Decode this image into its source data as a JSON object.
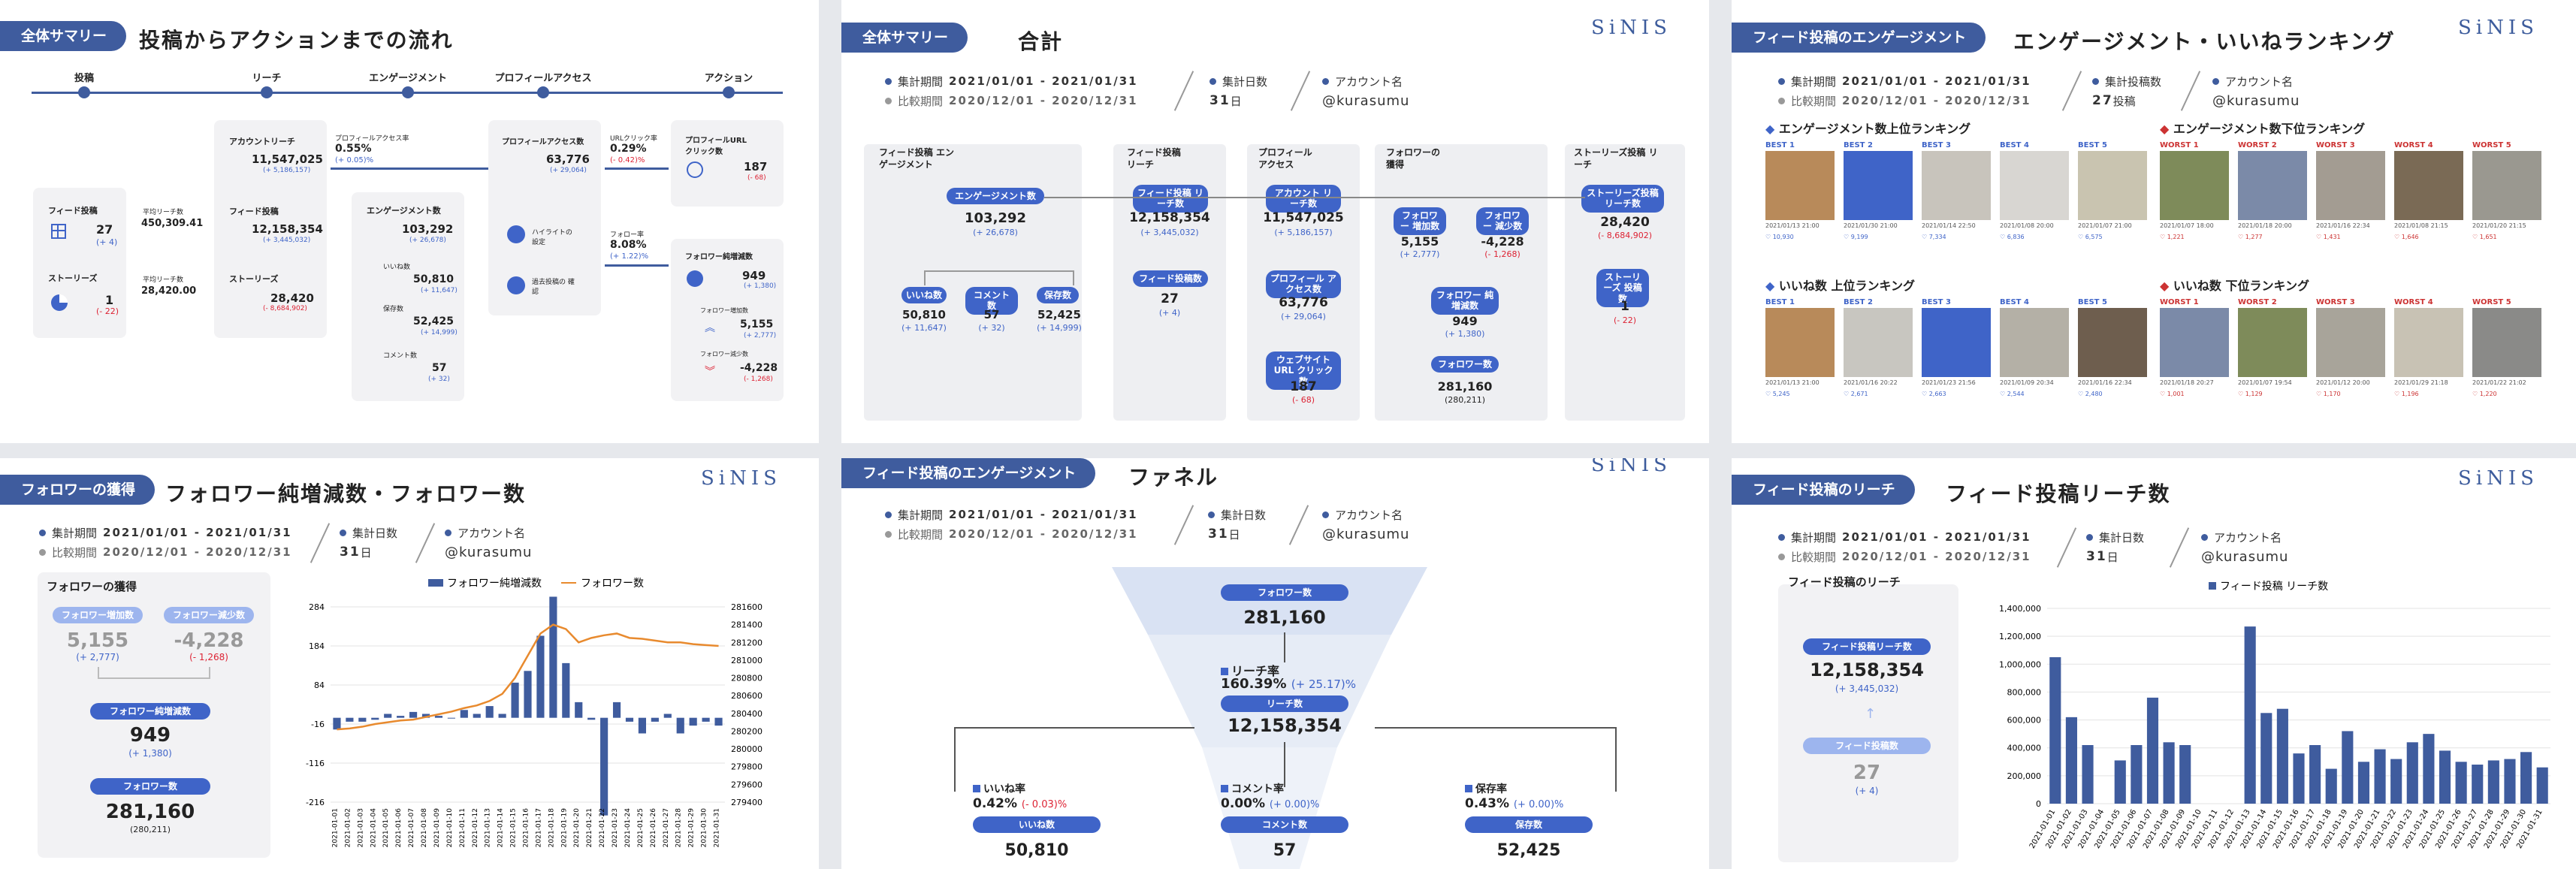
{
  "brand": "SiNIS",
  "meta_common": {
    "period_label": "集計期間",
    "period": "2021/01/01 - 2021/01/31",
    "compare_label": "比較期間",
    "compare": "2020/12/01 - 2020/12/31",
    "days_label": "集計日数",
    "days": "31",
    "days_unit": "日",
    "account_label": "アカウント名",
    "account": "@kurasumu",
    "posts_label": "集計投稿数",
    "posts": "27",
    "posts_unit": "投稿"
  },
  "p1": {
    "tag": "全体サマリー",
    "title": "投稿からアクションまでの流れ",
    "stages": [
      "投稿",
      "リーチ",
      "エンゲージメント",
      "プロフィールアクセス",
      "アクション"
    ],
    "feed_posts": {
      "label": "フィード投稿",
      "value": "27",
      "delta": "(+ 4)"
    },
    "stories": {
      "label": "ストーリーズ",
      "value": "1",
      "delta": "(- 22)"
    },
    "avg_reach1": {
      "label": "平均リーチ数",
      "value": "450,309.41"
    },
    "avg_reach2": {
      "label": "平均リーチ数",
      "value": "28,420.00"
    },
    "account_reach": {
      "label": "アカウントリーチ",
      "value": "11,547,025",
      "delta": "(+ 5,186,157)"
    },
    "feed_reach": {
      "label": "フィード投稿",
      "value": "12,158,354",
      "delta": "(+ 3,445,032)"
    },
    "story_reach": {
      "label": "ストーリーズ",
      "value": "28,420",
      "delta": "(- 8,684,902)"
    },
    "profile_rate": {
      "label": "プロフィールアクセス率",
      "value": "0.55%",
      "delta": "(+ 0.05)%"
    },
    "engagement": {
      "label": "エンゲージメント数",
      "value": "103,292",
      "delta": "(+ 26,678)"
    },
    "likes": {
      "label": "いいね数",
      "value": "50,810",
      "delta": "(+ 11,647)"
    },
    "saves": {
      "label": "保存数",
      "value": "52,425",
      "delta": "(+ 14,999)"
    },
    "comments": {
      "label": "コメント数",
      "value": "57",
      "delta": "(+ 32)"
    },
    "profile_access": {
      "label": "プロフィールアクセス数",
      "value": "63,776",
      "delta": "(+ 29,064)"
    },
    "highlight": "ハイライトの 設定",
    "past_posts": "過去投稿の 確認",
    "url_rate": {
      "label": "URLクリック率",
      "value": "0.29%",
      "delta": "(- 0.42)%"
    },
    "url_clicks": {
      "label": "プロフィールURL クリック数",
      "value": "187",
      "delta": "(- 68)"
    },
    "follow_rate": {
      "label": "フォロー率",
      "value": "8.08%",
      "delta": "(+ 1.22)%"
    },
    "net_follow": {
      "label": "フォロワー純増減数",
      "value": "949",
      "delta": "(+ 1,380)"
    },
    "follow_inc": {
      "label": "フォロワー増加数",
      "value": "5,155",
      "delta": "(+ 2,777)"
    },
    "follow_dec": {
      "label": "フォロワー減少数",
      "value": "-4,228",
      "delta": "(- 1,268)"
    }
  },
  "p2": {
    "tag": "全体サマリー",
    "title": "合計",
    "cols": [
      "フィード投稿 エンゲージメント",
      "フィード投稿 リーチ",
      "プロフィール アクセス",
      "フォロワーの 獲得",
      "ストーリーズ投稿 リーチ"
    ],
    "engagement": {
      "label": "エンゲージメント数",
      "value": "103,292",
      "delta": "(+ 26,678)"
    },
    "likes": {
      "label": "いいね数",
      "value": "50,810",
      "delta": "(+ 11,647)"
    },
    "comments": {
      "label": "コメント数",
      "value": "57",
      "delta": "(+ 32)"
    },
    "saves": {
      "label": "保存数",
      "value": "52,425",
      "delta": "(+ 14,999)"
    },
    "feed_reach": {
      "label": "フィード投稿 リーチ数",
      "value": "12,158,354",
      "delta": "(+ 3,445,032)"
    },
    "feed_posts": {
      "label": "フィード投稿数",
      "value": "27",
      "delta": "(+ 4)"
    },
    "account_reach": {
      "label": "アカウント リーチ数",
      "value": "11,547,025",
      "delta": "(+ 5,186,157)"
    },
    "profile_access": {
      "label": "プロフィール アクセス数",
      "value": "63,776",
      "delta": "(+ 29,064)"
    },
    "url_clicks": {
      "label": "ウェブサイトURL クリック数",
      "value": "187",
      "delta": "(- 68)"
    },
    "follow_inc": {
      "label": "フォロワー 増加数",
      "value": "5,155",
      "delta": "(+ 2,777)"
    },
    "follow_dec": {
      "label": "フォロワー 減少数",
      "value": "-4,228",
      "delta": "(- 1,268)"
    },
    "net_follow": {
      "label": "フォロワー 純増減数",
      "value": "949",
      "delta": "(+ 1,380)"
    },
    "followers": {
      "label": "フォロワー数",
      "value": "281,160",
      "delta": "(280,211)"
    },
    "story_reach": {
      "label": "ストーリーズ投稿 リーチ数",
      "value": "28,420",
      "delta": "(- 8,684,902)"
    },
    "story_posts": {
      "label": "ストーリーズ 投稿数",
      "value": "1",
      "delta": "(- 22)"
    }
  },
  "p3": {
    "tag": "フィード投稿のエンゲージメント",
    "title": "エンゲージメント・いいねランキング",
    "sections": [
      {
        "title": "エンゲージメント数上位ランキング",
        "kind": "best",
        "items": [
          {
            "badge": "BEST 1",
            "date": "2021/01/13 21:00",
            "val": "10,930",
            "color": "#b88a5a"
          },
          {
            "badge": "BEST 2",
            "date": "2021/01/30 21:00",
            "val": "9,199",
            "color": "#3f64c8"
          },
          {
            "badge": "BEST 3",
            "date": "2021/01/14 22:50",
            "val": "7,334",
            "color": "#c8c4bc"
          },
          {
            "badge": "BEST 4",
            "date": "2021/01/08 20:00",
            "val": "6,836",
            "color": "#d8d6d2"
          },
          {
            "badge": "BEST 5",
            "date": "2021/01/07 21:00",
            "val": "6,575",
            "color": "#c9c4b0"
          }
        ]
      },
      {
        "title": "エンゲージメント数下位ランキング",
        "kind": "worst",
        "items": [
          {
            "badge": "WORST 1",
            "date": "2021/01/07 18:00",
            "val": "1,221",
            "color": "#7e8b5a"
          },
          {
            "badge": "WORST 2",
            "date": "2021/01/18 20:00",
            "val": "1,277",
            "color": "#7b8aa8"
          },
          {
            "badge": "WORST 3",
            "date": "2021/01/16 22:34",
            "val": "1,431",
            "color": "#a39c92"
          },
          {
            "badge": "WORST 4",
            "date": "2021/01/08 21:15",
            "val": "1,646",
            "color": "#7a6a55"
          },
          {
            "badge": "WORST 5",
            "date": "2021/01/20 21:15",
            "val": "1,651",
            "color": "#9a9890"
          }
        ]
      },
      {
        "title": "いいね数 上位ランキング",
        "kind": "best",
        "items": [
          {
            "badge": "BEST 1",
            "date": "2021/01/13 21:00",
            "val": "5,245",
            "color": "#b88a5a"
          },
          {
            "badge": "BEST 2",
            "date": "2021/01/16 20:22",
            "val": "2,671",
            "color": "#c8c6c0"
          },
          {
            "badge": "BEST 3",
            "date": "2021/01/23 21:56",
            "val": "2,663",
            "color": "#3f64c8"
          },
          {
            "badge": "BEST 4",
            "date": "2021/01/09 20:34",
            "val": "2,544",
            "color": "#b4b0a6"
          },
          {
            "badge": "BEST 5",
            "date": "2021/01/16 22:34",
            "val": "2,480",
            "color": "#6e5e4e"
          }
        ]
      },
      {
        "title": "いいね数 下位ランキング",
        "kind": "worst",
        "items": [
          {
            "badge": "WORST 1",
            "date": "2021/01/18 20:27",
            "val": "1,001",
            "color": "#7b8aa8"
          },
          {
            "badge": "WORST 2",
            "date": "2021/01/07 19:54",
            "val": "1,129",
            "color": "#7e8b5a"
          },
          {
            "badge": "WORST 3",
            "date": "2021/01/12 20:00",
            "val": "1,170",
            "color": "#a8a49a"
          },
          {
            "badge": "WORST 4",
            "date": "2021/01/29 21:18",
            "val": "1,196",
            "color": "#c8c2b4"
          },
          {
            "badge": "WORST 5",
            "date": "2021/01/22 21:02",
            "val": "1,220",
            "color": "#8a8a88"
          }
        ]
      }
    ]
  },
  "p4": {
    "tag": "フォロワーの獲得",
    "title": "フォロワー純増減数・フォロワー数",
    "card_title": "フォロワーの獲得",
    "inc": {
      "label": "フォロワー増加数",
      "value": "5,155",
      "delta": "(+ 2,777)"
    },
    "dec": {
      "label": "フォロワー減少数",
      "value": "-4,228",
      "delta": "(- 1,268)"
    },
    "net": {
      "label": "フォロワー純増減数",
      "value": "949",
      "delta": "(+ 1,380)"
    },
    "followers": {
      "label": "フォロワー数",
      "value": "281,160",
      "delta": "(280,211)"
    }
  },
  "p5": {
    "tag": "フィード投稿のエンゲージメント",
    "title": "ファネル",
    "followers": {
      "label": "フォロワー数",
      "value": "281,160"
    },
    "reach_rate": {
      "label": "リーチ率",
      "value": "160.39%",
      "delta": "(+ 25.17)%"
    },
    "reach": {
      "label": "リーチ数",
      "value": "12,158,354"
    },
    "like_rate": {
      "label": "いいね率",
      "value": "0.42%",
      "delta": "(- 0.03)%"
    },
    "comment_rate": {
      "label": "コメント率",
      "value": "0.00%",
      "delta": "(+ 0.00)%"
    },
    "save_rate": {
      "label": "保存率",
      "value": "0.43%",
      "delta": "(+ 0.00)%"
    },
    "likes": {
      "label": "いいね数",
      "value": "50,810"
    },
    "comments": {
      "label": "コメント数",
      "value": "57"
    },
    "saves": {
      "label": "保存数",
      "value": "52,425"
    }
  },
  "p6": {
    "tag": "フィード投稿のリーチ",
    "title": "フィード投稿リーチ数",
    "card_title": "フィード投稿のリーチ",
    "reach": {
      "label": "フィード投稿リーチ数",
      "value": "12,158,354",
      "delta": "(+ 3,445,032)"
    },
    "posts": {
      "label": "フィード投稿数",
      "value": "27",
      "delta": "(+ 4)"
    }
  },
  "chart_data": [
    {
      "type": "bar+line",
      "legend": [
        "フォロワー純増減数",
        "フォロワー数"
      ],
      "categories": [
        "2021-01-01",
        "2021-01-02",
        "2021-01-03",
        "2021-01-04",
        "2021-01-05",
        "2021-01-06",
        "2021-01-07",
        "2021-01-08",
        "2021-01-09",
        "2021-01-10",
        "2021-01-11",
        "2021-01-12",
        "2021-01-13",
        "2021-01-14",
        "2021-01-15",
        "2021-01-16",
        "2021-01-17",
        "2021-01-18",
        "2021-01-19",
        "2021-01-20",
        "2021-01-21",
        "2021-01-22",
        "2021-01-23",
        "2021-01-24",
        "2021-01-25",
        "2021-01-26",
        "2021-01-27",
        "2021-01-28",
        "2021-01-29",
        "2021-01-30",
        "2021-01-31"
      ],
      "series": [
        {
          "name": "フォロワー純増減数",
          "axis": "left",
          "values": [
            -30,
            -10,
            -10,
            -5,
            10,
            5,
            15,
            10,
            5,
            0,
            20,
            10,
            30,
            10,
            90,
            120,
            210,
            310,
            140,
            40,
            -5,
            -250,
            40,
            -10,
            -40,
            -10,
            10,
            -40,
            -20,
            -10,
            -20
          ]
        },
        {
          "name": "フォロワー数",
          "axis": "right",
          "values": [
            280220,
            280230,
            280250,
            280280,
            280300,
            280320,
            280330,
            280360,
            280390,
            280420,
            280460,
            280490,
            280540,
            280620,
            280800,
            281050,
            281300,
            281400,
            281350,
            281200,
            281250,
            281280,
            281300,
            281250,
            281240,
            281220,
            281200,
            281200,
            281180,
            281170,
            281160
          ]
        }
      ],
      "y_left_ticks": [
        284,
        184,
        84,
        -16,
        -116,
        -216
      ],
      "y_right_ticks": [
        281600,
        281400,
        281200,
        281000,
        280800,
        280600,
        280400,
        280200,
        280000,
        279800,
        279600,
        279400
      ]
    },
    {
      "type": "bar",
      "legend": [
        "フィード投稿 リーチ数"
      ],
      "categories": [
        "2021-01-01",
        "2021-01-02",
        "2021-01-03",
        "2021-01-04",
        "2021-01-05",
        "2021-01-06",
        "2021-01-07",
        "2021-01-08",
        "2021-01-09",
        "2021-01-10",
        "2021-01-11",
        "2021-01-12",
        "2021-01-13",
        "2021-01-14",
        "2021-01-15",
        "2021-01-16",
        "2021-01-17",
        "2021-01-18",
        "2021-01-19",
        "2021-01-20",
        "2021-01-21",
        "2021-01-22",
        "2021-01-23",
        "2021-01-24",
        "2021-01-25",
        "2021-01-26",
        "2021-01-27",
        "2021-01-28",
        "2021-01-29",
        "2021-01-30",
        "2021-01-31"
      ],
      "values": [
        1050000,
        620000,
        420000,
        0,
        310000,
        420000,
        760000,
        440000,
        420000,
        0,
        0,
        0,
        1270000,
        650000,
        680000,
        360000,
        420000,
        250000,
        520000,
        300000,
        390000,
        320000,
        440000,
        500000,
        380000,
        300000,
        280000,
        310000,
        320000,
        370000,
        260000
      ],
      "y_ticks": [
        1400000,
        1200000,
        1000000,
        800000,
        600000,
        400000,
        200000,
        0
      ],
      "y_tick_labels": [
        "1,400,000",
        "1,200,000",
        "1,000,000",
        "800,000",
        "600,000",
        "400,000",
        "200,000",
        "0"
      ]
    }
  ]
}
